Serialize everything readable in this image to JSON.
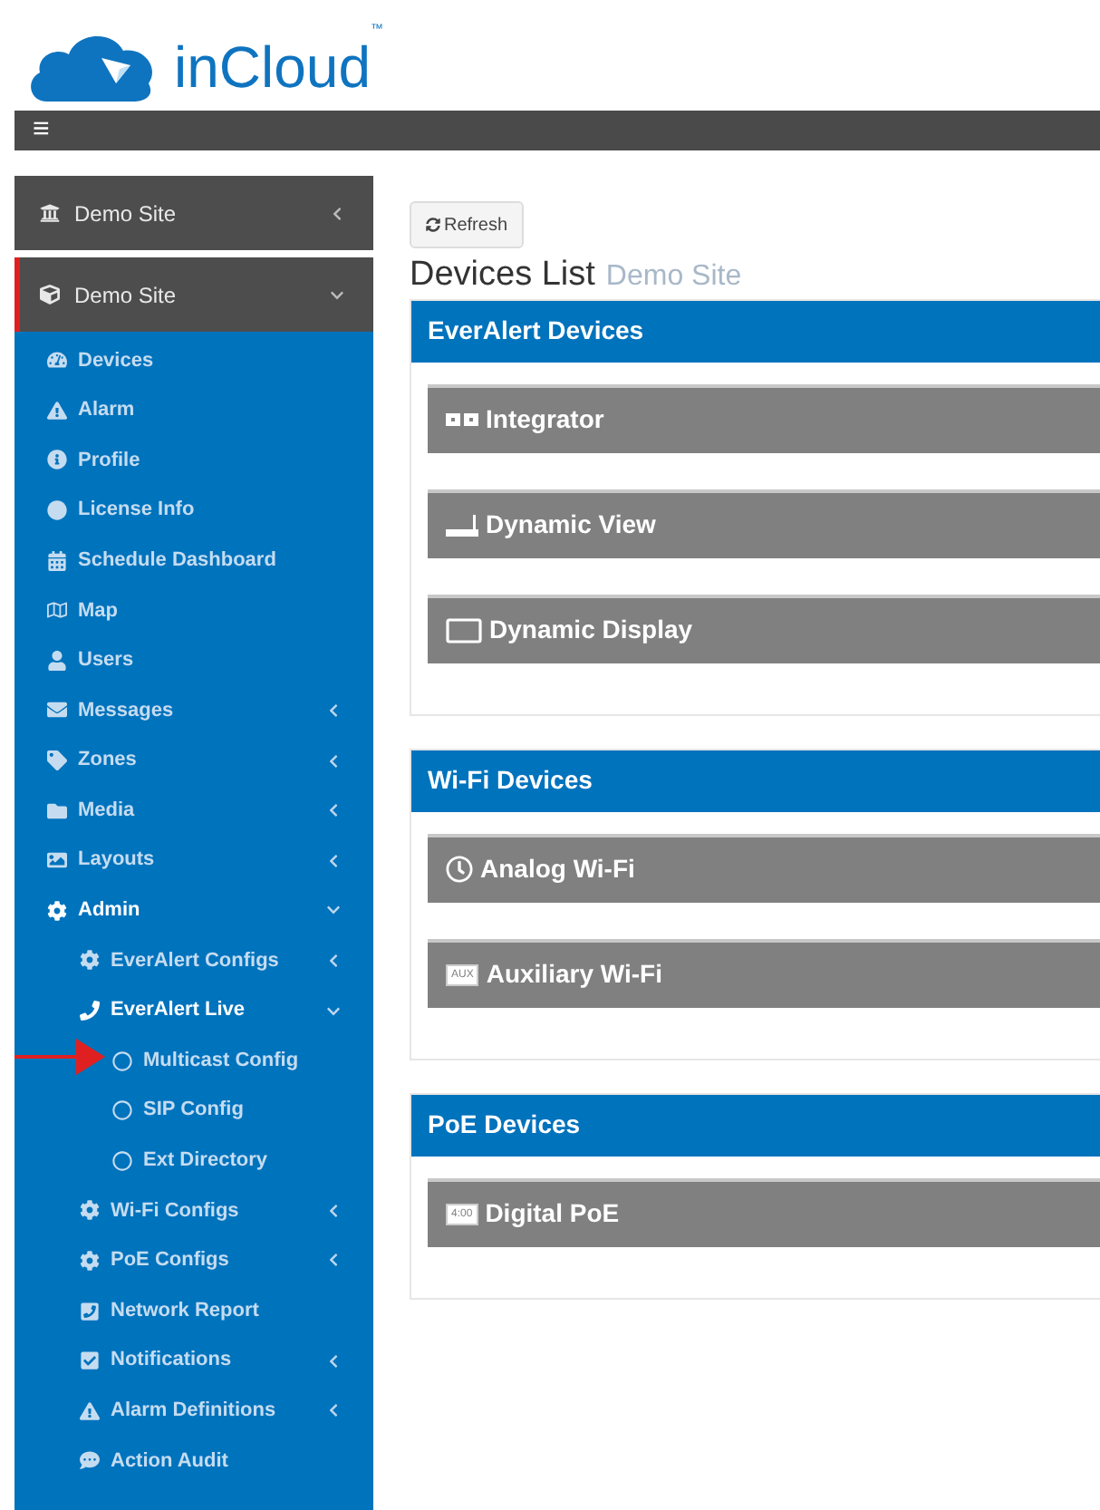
{
  "logo": {
    "text": "inCloud",
    "mark": "™"
  },
  "toolbar": {
    "menu_glyph": "≡"
  },
  "sidebar": {
    "sections": [
      {
        "label": "Demo Site",
        "expanded": false,
        "selected": false
      },
      {
        "label": "Demo Site",
        "expanded": true,
        "selected": true,
        "children": [
          {
            "label": "Devices"
          },
          {
            "label": "Alarm"
          },
          {
            "label": "Profile"
          },
          {
            "label": "License Info"
          },
          {
            "label": "Schedule Dashboard"
          },
          {
            "label": "Map"
          },
          {
            "label": "Users"
          },
          {
            "label": "Messages",
            "expanded": false
          },
          {
            "label": "Zones",
            "expanded": false
          },
          {
            "label": "Media",
            "expanded": false
          },
          {
            "label": "Layouts",
            "expanded": false
          },
          {
            "label": "Admin",
            "expanded": true,
            "children": [
              {
                "label": "EverAlert Configs",
                "expanded": false
              },
              {
                "label": "EverAlert Live",
                "expanded": true,
                "children": [
                  {
                    "label": "Multicast Config"
                  },
                  {
                    "label": "SIP Config"
                  },
                  {
                    "label": "Ext Directory"
                  }
                ]
              },
              {
                "label": "Wi-Fi Configs",
                "expanded": false
              },
              {
                "label": "PoE Configs",
                "expanded": false
              },
              {
                "label": "Network Report"
              },
              {
                "label": "Notifications",
                "expanded": false
              },
              {
                "label": "Alarm Definitions",
                "expanded": false
              },
              {
                "label": "Action Audit"
              }
            ]
          }
        ]
      }
    ]
  },
  "refresh_button": "Refresh",
  "page_title": "Devices List",
  "page_subtitle": "Demo Site",
  "panels": [
    {
      "title": "EverAlert Devices",
      "devices": [
        {
          "label": "Integrator"
        },
        {
          "label": "Dynamic View"
        },
        {
          "label": "Dynamic Display"
        }
      ]
    },
    {
      "title": "Wi-Fi Devices",
      "devices": [
        {
          "label": "Analog Wi-Fi"
        },
        {
          "label": "Auxiliary Wi-Fi",
          "icon_text": "AUX"
        }
      ]
    },
    {
      "title": "PoE Devices",
      "devices": [
        {
          "label": "Digital PoE",
          "icon_text": "4:00"
        }
      ]
    }
  ]
}
